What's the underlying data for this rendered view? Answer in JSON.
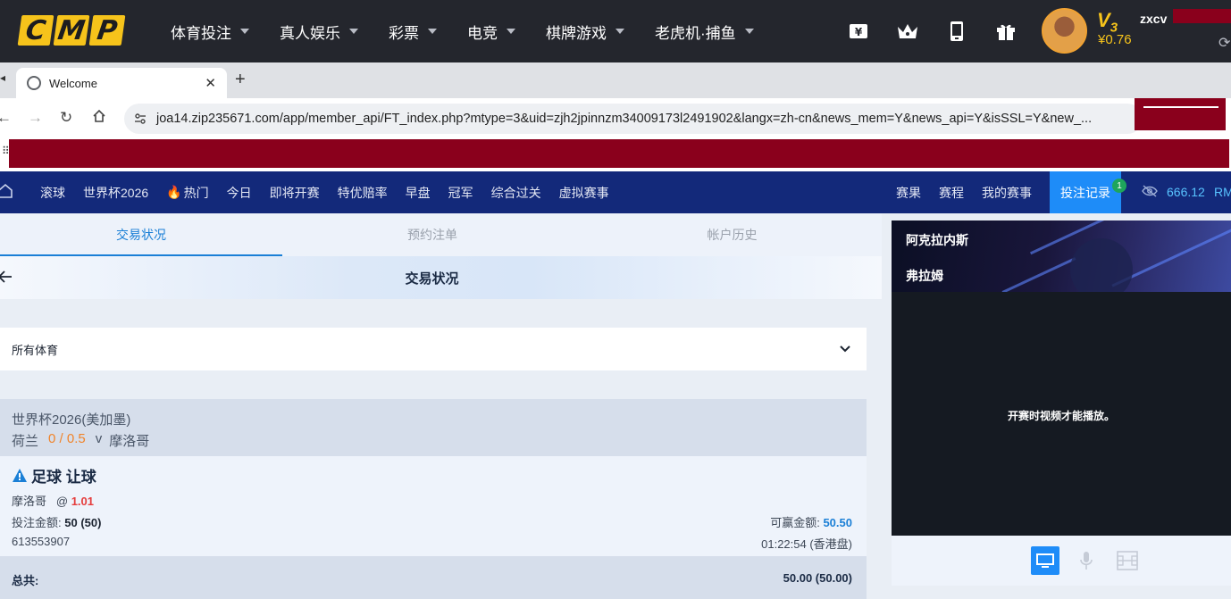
{
  "app": {
    "logo_letters": [
      "C",
      "M",
      "P"
    ],
    "nav": [
      {
        "label": "体育投注"
      },
      {
        "label": "真人娱乐"
      },
      {
        "label": "彩票"
      },
      {
        "label": "电竞"
      },
      {
        "label": "棋牌游戏"
      },
      {
        "label": "老虎机·捕鱼"
      }
    ],
    "header_icons": [
      "yen-card-icon",
      "crown-icon",
      "phone-icon",
      "gift-icon"
    ],
    "vip_level": "V",
    "vip_num": "3",
    "balance": "¥0.76",
    "username": "zxcv"
  },
  "browser": {
    "tab_title": "Welcome",
    "url": "joa14.zip235671.com/app/member_api/FT_index.php?mtype=3&uid=zjh2jpinnzm34009173l2491902&langx=zh-cn&news_mem=Y&news_api=Y&isSSL=Y&new_..."
  },
  "site_nav": {
    "left": [
      "滚球",
      "世界杯2026",
      "热门",
      "今日",
      "即将开赛",
      "特优赔率",
      "早盘",
      "冠军",
      "综合过关",
      "虚拟赛事"
    ],
    "right": [
      "赛果",
      "赛程",
      "我的赛事"
    ],
    "active": "投注记录",
    "badge": "1",
    "balance": "666.12",
    "currency": "RM"
  },
  "main": {
    "tabs": [
      "交易状况",
      "预约注单",
      "帐户历史"
    ],
    "page_title": "交易状况",
    "sport_filter": "所有体育",
    "bet": {
      "league": "世界杯2026(美加墨)",
      "home": "荷兰",
      "handicap": "0 / 0.5",
      "vs": "v",
      "away": "摩洛哥",
      "type": "足球 让球",
      "pick": "摩洛哥",
      "at": "@",
      "odds": "1.01",
      "stake_label": "投注金额:",
      "stake": "50 (50)",
      "win_label": "可赢金额:",
      "win": "50.50",
      "ticket_id": "613553907",
      "time": "01:22:54 (香港盘)"
    },
    "total_label": "总共:",
    "total_value": "50.00 (50.00)"
  },
  "side": {
    "team_a": "阿克拉内斯",
    "team_b": "弗拉姆",
    "video_message": "开赛时视频才能播放。"
  },
  "colors": {
    "header_bg": "#24262d",
    "logo_yellow": "#f6c31b",
    "site_nav_bg": "#13297a",
    "active_blue": "#1e8cf8",
    "redaction": "#8a001c",
    "handicap_orange": "#f0842b",
    "odds_red": "#e53c3c"
  }
}
